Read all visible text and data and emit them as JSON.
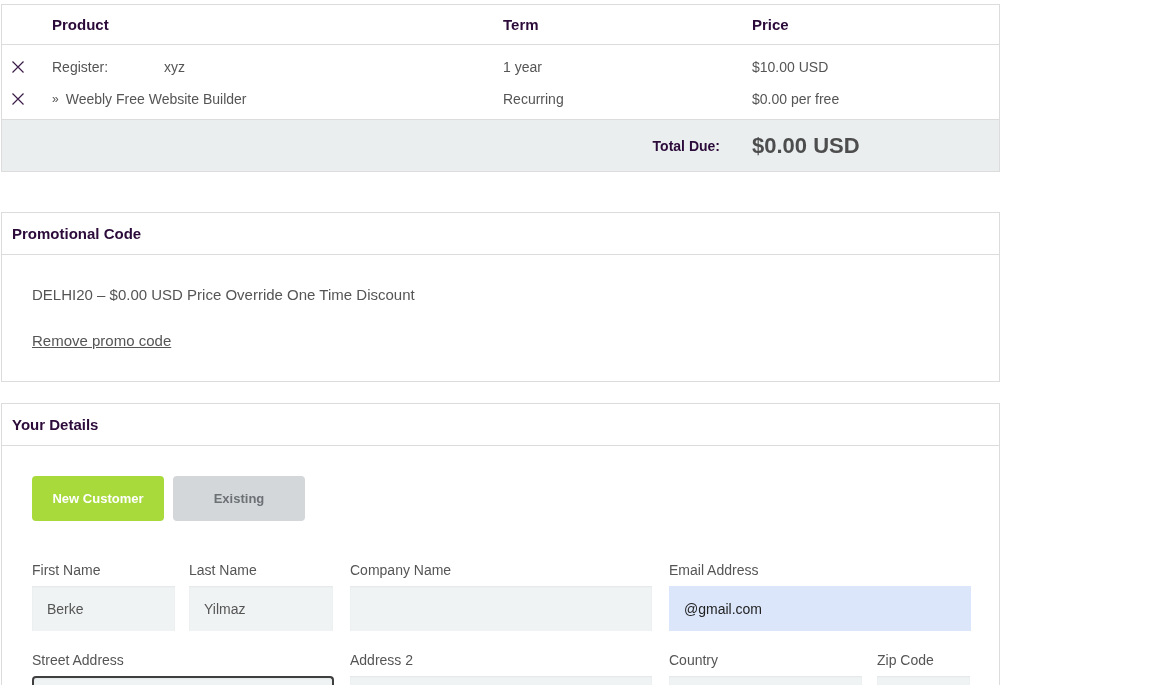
{
  "cart": {
    "columns": [
      "Product",
      "Term",
      "Price"
    ],
    "items": [
      {
        "kind": "domain",
        "label": "Register:",
        "name": "xyz",
        "term": "1 year",
        "price": "$10.00 USD"
      },
      {
        "kind": "addon",
        "label": "»",
        "name": "Weebly Free Website Builder",
        "term": "Recurring",
        "price": "$0.00 per free"
      }
    ],
    "total_label": "Total Due:",
    "total": "$0.00 USD"
  },
  "promo": {
    "title": "Promotional Code",
    "applied": "DELHI20 – $0.00 USD Price Override One Time Discount",
    "remove_link": "Remove promo code"
  },
  "details": {
    "title": "Your Details",
    "customer_tabs": [
      {
        "label": "New Customer",
        "selected": true
      },
      {
        "label": "Existing",
        "selected": false
      }
    ],
    "field_rows": [
      {
        "fields": [
          {
            "label": "First Name",
            "value": "Berke",
            "autofilled": false,
            "focused": false
          },
          {
            "label": "Last Name",
            "value": "Yilmaz",
            "autofilled": false,
            "focused": false
          },
          {
            "label": "Company Name",
            "autofilled": false,
            "focused": false
          },
          {
            "label": "Email Address",
            "value": "@gmail.com",
            "autofilled": true,
            "focused": false
          }
        ]
      },
      {
        "fields": [
          {
            "label": "Street Address",
            "autofilled": false,
            "focused": true
          },
          {
            "label": "Address 2",
            "autofilled": false,
            "focused": false
          },
          {
            "label": "Country",
            "autofilled": false,
            "focused": false
          },
          {
            "label": "Zip Code",
            "autofilled": false,
            "focused": false
          }
        ]
      }
    ]
  }
}
